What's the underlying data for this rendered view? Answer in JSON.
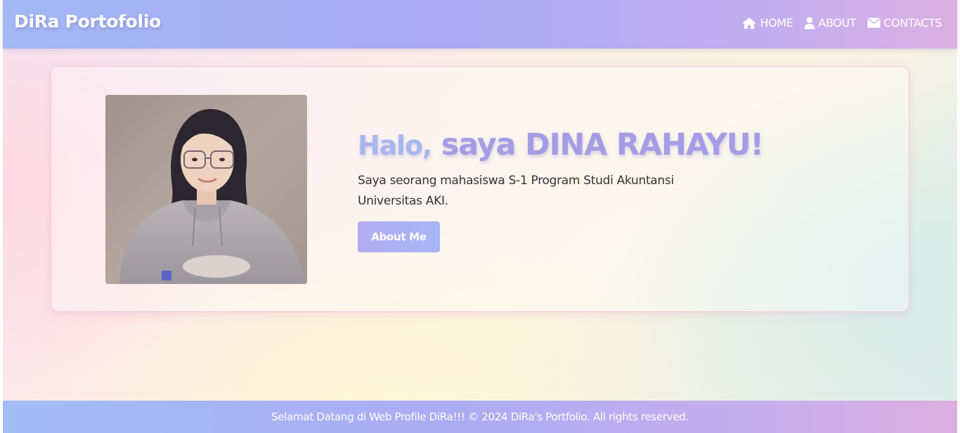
{
  "navbar": {
    "brand": "DiRa Portofolio",
    "items": [
      {
        "label": "HOME",
        "icon": "home-icon"
      },
      {
        "label": "ABOUT",
        "icon": "user-icon"
      },
      {
        "label": "CONTACTS",
        "icon": "envelope-icon"
      }
    ]
  },
  "hero": {
    "greeting": "Halo,",
    "name": "saya DINA RAHAYU!",
    "description": "Saya seorang mahasiswa S-1 Program Studi Akuntansi Universitas AKI.",
    "button_label": "About Me"
  },
  "footer": {
    "text": "Selamat Datang di Web Profile DiRa!!! © 2024 DiRa's Portfolio. All rights reserved."
  },
  "colors": {
    "accent_blue": "#a6b6ef",
    "accent_purple": "#a49de6",
    "card_border": "#f7c8d6"
  }
}
